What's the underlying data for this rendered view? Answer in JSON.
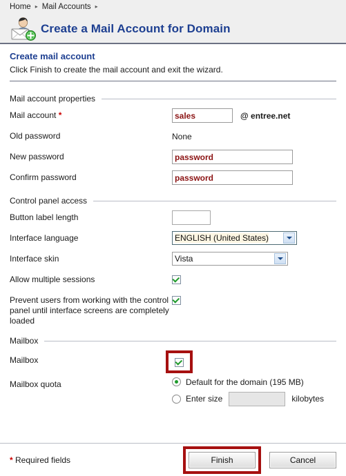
{
  "breadcrumb": {
    "items": [
      "Home",
      "Mail Accounts"
    ],
    "separator": "▸"
  },
  "header": {
    "icon": "mail-account-add-icon",
    "title": "Create a Mail Account for Domain"
  },
  "step": {
    "title": "Create mail account",
    "description": "Click Finish to create the mail account and exit the wizard."
  },
  "sections": {
    "mail_account_properties": {
      "legend": "Mail account properties",
      "mail_account_label": "Mail account",
      "required_marker": "*",
      "mail_account_value": "sales",
      "domain_suffix": "@ entree.net",
      "old_password_label": "Old password",
      "old_password_value": "None",
      "new_password_label": "New password",
      "new_password_value": "password",
      "confirm_password_label": "Confirm password",
      "confirm_password_value": "password"
    },
    "control_panel_access": {
      "legend": "Control panel access",
      "button_label_length_label": "Button label length",
      "button_label_length_value": "",
      "interface_language_label": "Interface language",
      "interface_language_value": "ENGLISH (United States)",
      "interface_skin_label": "Interface skin",
      "interface_skin_value": "Vista",
      "allow_multiple_sessions_label": "Allow multiple sessions",
      "allow_multiple_sessions_checked": true,
      "prevent_users_label": "Prevent users from working with the control panel until interface screens are completely loaded",
      "prevent_users_checked": true
    },
    "mailbox": {
      "legend": "Mailbox",
      "mailbox_label": "Mailbox",
      "mailbox_checked": true,
      "quota_label": "Mailbox quota",
      "quota_default_option": "Default for the domain (195 MB)",
      "quota_default_selected": true,
      "quota_enter_size_option": "Enter size",
      "quota_enter_size_value": "",
      "quota_units": "kilobytes"
    }
  },
  "footer": {
    "required_star": "*",
    "required_note": "Required fields",
    "finish_label": "Finish",
    "cancel_label": "Cancel"
  },
  "colors": {
    "title_blue": "#1d3f91",
    "highlight_red": "#a61010",
    "input_text_red": "#8b1313",
    "check_green": "#1e9b2a"
  }
}
